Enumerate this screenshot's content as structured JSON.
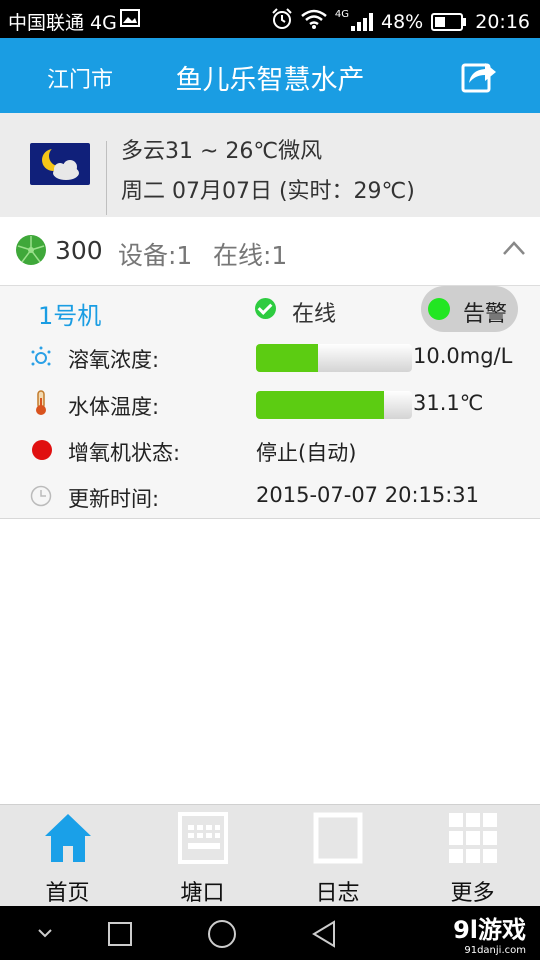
{
  "status_bar": {
    "carrier": "中国联通 4G",
    "network_badge": "4G",
    "battery": "48%",
    "battery_level": 0.48,
    "time": "20:16",
    "icons": [
      "image-icon",
      "alarm-clock-icon",
      "wifi-icon",
      "signal-icon",
      "battery-icon"
    ]
  },
  "header": {
    "city": "江门市",
    "title": "鱼儿乐智慧水产",
    "share_icon": "share-icon"
  },
  "weather": {
    "icon": "moon-cloud-icon",
    "summary": "多云31 ~ 26℃微风",
    "detail": "周二 07月07日 (实时：29℃)"
  },
  "pond": {
    "icon": "lotus-leaf-icon",
    "name": "300",
    "devices": "设备:1",
    "online": "在线:1",
    "collapse_icon": "chevron-up-icon"
  },
  "device": {
    "name": "1号机",
    "status": "在线",
    "alarm_label": "告警",
    "rows": {
      "oxygen": {
        "label": "溶氧浓度:",
        "value": "10.0mg/L",
        "level": 0.4,
        "icon": "oxygen-icon"
      },
      "temperature": {
        "label": "水体温度:",
        "value": "31.1℃",
        "level": 0.82,
        "icon": "thermometer-icon"
      },
      "aerator": {
        "label": "增氧机状态:",
        "value": "停止(自动)",
        "icon": "red-dot-icon"
      },
      "updated": {
        "label": "更新时间:",
        "value": "2015-07-07 20:15:31",
        "icon": "clock-icon"
      }
    }
  },
  "colors": {
    "accent": "#1a9de3",
    "progress": "#5ccc12",
    "online": "#2ecc40",
    "alarm_dot": "#22e622",
    "stopped": "#e01010"
  },
  "bottom_nav": [
    {
      "label": "首页",
      "icon": "home-icon",
      "active": true
    },
    {
      "label": "塘口",
      "icon": "keyboard-icon",
      "active": false
    },
    {
      "label": "日志",
      "icon": "square-icon",
      "active": false
    },
    {
      "label": "更多",
      "icon": "grid-icon",
      "active": false
    }
  ],
  "watermark": {
    "brand": "9l游戏",
    "site": "91danji.com"
  }
}
